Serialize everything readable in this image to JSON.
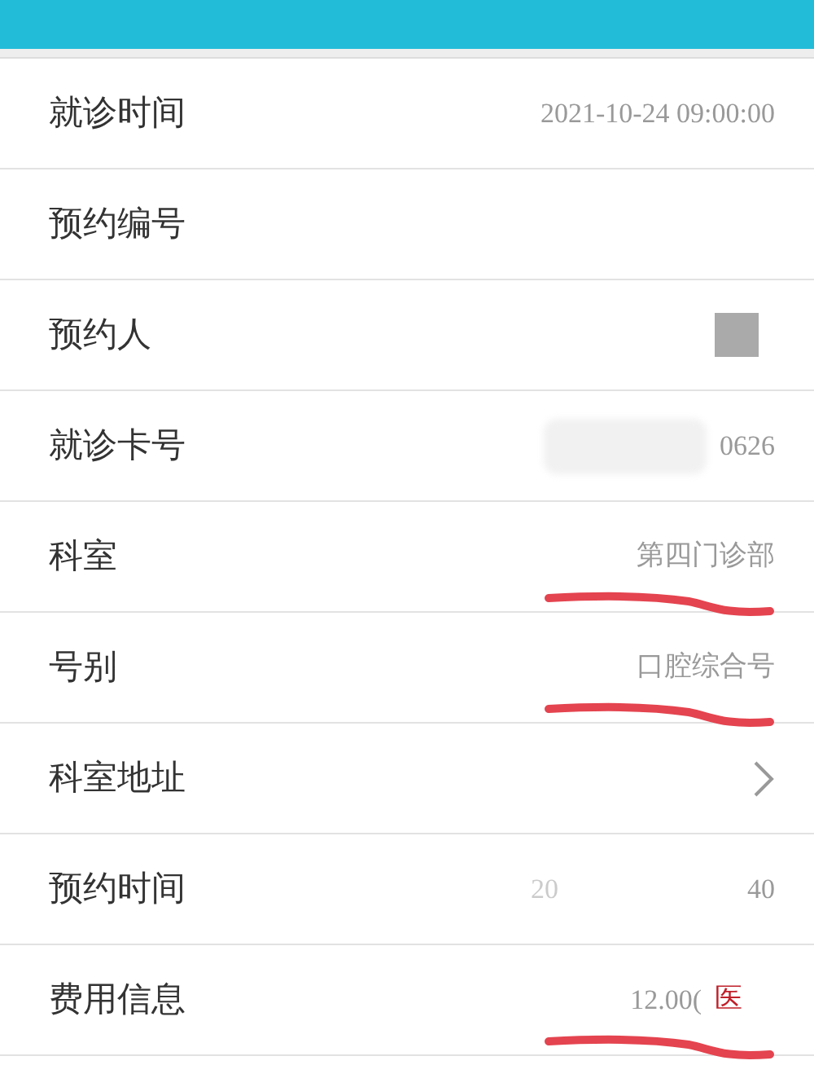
{
  "rows": [
    {
      "label": "就诊时间",
      "kind": "text",
      "value": "2021-10-24 09:00:00",
      "underlined": false
    },
    {
      "label": "预约编号",
      "kind": "empty",
      "underlined": false
    },
    {
      "label": "预约人",
      "kind": "redacted",
      "underlined": false
    },
    {
      "label": "就诊卡号",
      "kind": "smudged",
      "value": "0626",
      "underlined": false
    },
    {
      "label": "科室",
      "kind": "text",
      "value": "第四门诊部",
      "underlined": true
    },
    {
      "label": "号别",
      "kind": "text",
      "value": "口腔综合号",
      "underlined": true
    },
    {
      "label": "科室地址",
      "kind": "link",
      "underlined": false
    },
    {
      "label": "预约时间",
      "kind": "split",
      "value": "20",
      "value_end": "40",
      "underlined": false
    },
    {
      "label": "费用信息",
      "kind": "fee",
      "value": "12.00(",
      "tag": "医",
      "underlined": true
    }
  ]
}
